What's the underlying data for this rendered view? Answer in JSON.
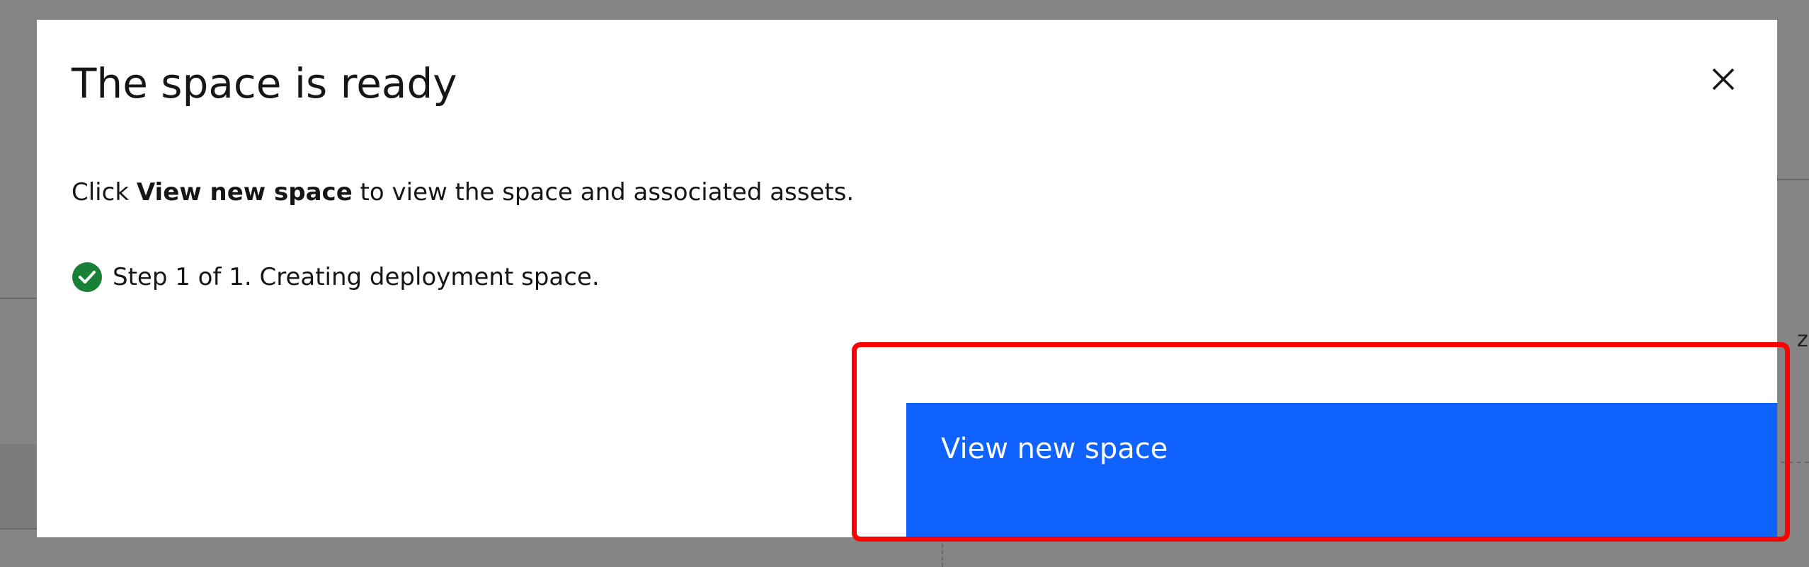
{
  "modal": {
    "title": "The space is ready",
    "description_prefix": "Click ",
    "description_bold": "View new space",
    "description_suffix": " to view the space and associated assets.",
    "step_text": "Step 1 of 1. Creating deployment space.",
    "step_status_icon": "checkmark-filled-icon",
    "close_icon": "close-icon",
    "primary_button_label": "View new space"
  },
  "background": {
    "edge_glyph": "z"
  },
  "colors": {
    "primary": "#0f62fe",
    "success": "#198038",
    "highlight": "#ff0000",
    "overlay": "#858585",
    "text": "#161616"
  }
}
